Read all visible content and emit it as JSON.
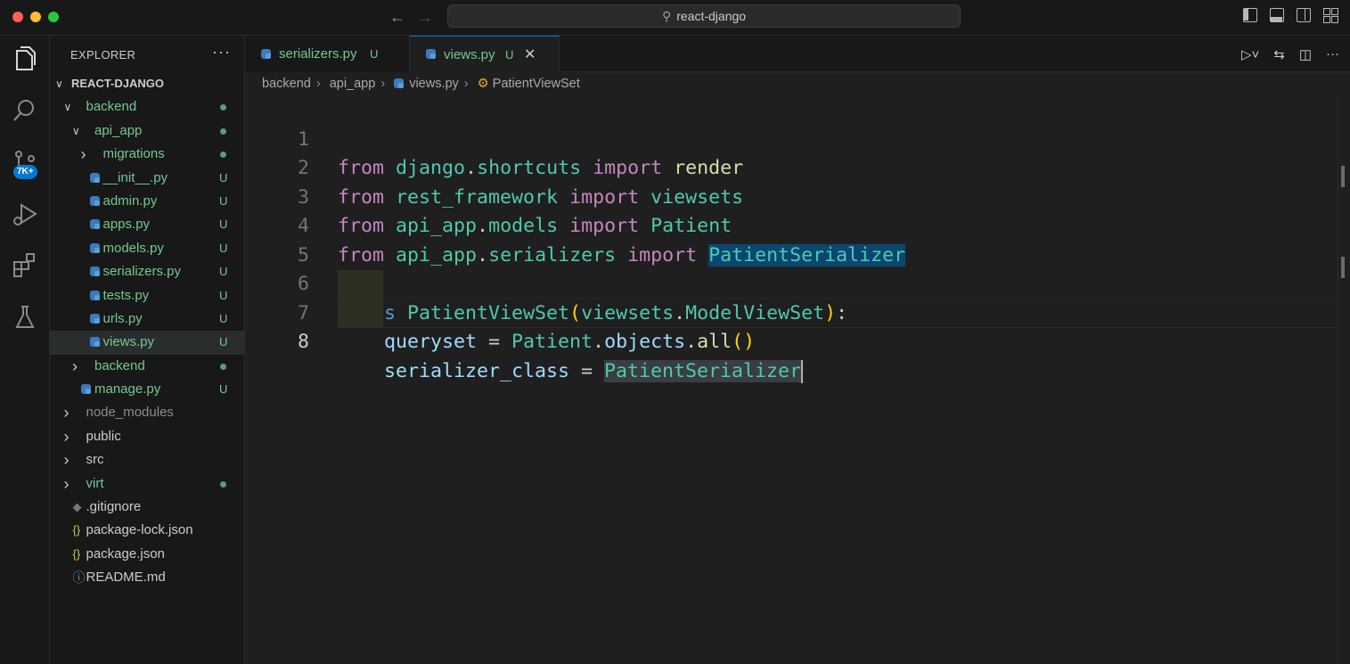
{
  "window": {
    "title": "react-django",
    "traffic_lights": {
      "close": "#ff5f57",
      "minimize": "#febc2e",
      "zoom": "#28c840"
    }
  },
  "activity_bar": {
    "items": [
      "explorer-icon",
      "search-icon",
      "source-control-icon",
      "run-debug-icon",
      "extensions-icon",
      "testing-icon"
    ],
    "source_control_badge": "7K+"
  },
  "explorer": {
    "header": "EXPLORER",
    "more": "···",
    "tree": [
      {
        "label": "REACT-DJANGO",
        "type": "root",
        "expanded": true,
        "depth": 0,
        "status": ""
      },
      {
        "label": "backend",
        "type": "folder",
        "expanded": true,
        "depth": 1,
        "status": "dot"
      },
      {
        "label": "api_app",
        "type": "folder",
        "expanded": true,
        "depth": 2,
        "status": "dot"
      },
      {
        "label": "migrations",
        "type": "folder",
        "expanded": false,
        "depth": 3,
        "status": "dot"
      },
      {
        "label": "__init__.py",
        "type": "py",
        "depth": 3,
        "status": "U"
      },
      {
        "label": "admin.py",
        "type": "py",
        "depth": 3,
        "status": "U"
      },
      {
        "label": "apps.py",
        "type": "py",
        "depth": 3,
        "status": "U"
      },
      {
        "label": "models.py",
        "type": "py",
        "depth": 3,
        "status": "U"
      },
      {
        "label": "serializers.py",
        "type": "py",
        "depth": 3,
        "status": "U"
      },
      {
        "label": "tests.py",
        "type": "py",
        "depth": 3,
        "status": "U"
      },
      {
        "label": "urls.py",
        "type": "py",
        "depth": 3,
        "status": "U"
      },
      {
        "label": "views.py",
        "type": "py",
        "depth": 3,
        "status": "U",
        "selected": true
      },
      {
        "label": "backend",
        "type": "folder",
        "expanded": false,
        "depth": 2,
        "status": "dot"
      },
      {
        "label": "manage.py",
        "type": "py",
        "depth": 2,
        "status": "U"
      },
      {
        "label": "node_modules",
        "type": "folder",
        "expanded": false,
        "depth": 1,
        "status": "",
        "dim": true
      },
      {
        "label": "public",
        "type": "folder",
        "expanded": false,
        "depth": 1,
        "status": ""
      },
      {
        "label": "src",
        "type": "folder",
        "expanded": false,
        "depth": 1,
        "status": ""
      },
      {
        "label": "virt",
        "type": "folder",
        "expanded": false,
        "depth": 1,
        "status": "dot"
      },
      {
        "label": ".gitignore",
        "type": "git",
        "depth": 1,
        "status": ""
      },
      {
        "label": "package-lock.json",
        "type": "json",
        "depth": 1,
        "status": ""
      },
      {
        "label": "package.json",
        "type": "json",
        "depth": 1,
        "status": ""
      },
      {
        "label": "README.md",
        "type": "info",
        "depth": 1,
        "status": ""
      }
    ]
  },
  "tabs": [
    {
      "name": "serializers.py",
      "status": "U",
      "active": false
    },
    {
      "name": "views.py",
      "status": "U",
      "active": true,
      "close": "✕"
    }
  ],
  "breadcrumb": [
    "backend",
    "api_app",
    "views.py",
    "PatientViewSet"
  ],
  "editor": {
    "lines": [
      {
        "num": "1"
      },
      {
        "num": "2"
      },
      {
        "num": "3"
      },
      {
        "num": "4"
      },
      {
        "num": "5"
      },
      {
        "num": "6"
      },
      {
        "num": "7"
      },
      {
        "num": "8",
        "current": true
      }
    ],
    "tokens": {
      "from": "from",
      "import": "import",
      "class": "class",
      "django": "django",
      "dot": ".",
      "shortcuts": "shortcuts",
      "render": "render",
      "rest_framework": "rest_framework",
      "viewsets": "viewsets",
      "api_app": "api_app",
      "models": "models",
      "Patient": "Patient",
      "serializers": "serializers",
      "PatientSerializer": "PatientSerializer",
      "PatientViewSet": "PatientViewSet",
      "lparen": "(",
      "rparen": ")",
      "colon": ":",
      "ModelViewSet": "ModelViewSet",
      "queryset": "queryset",
      "eq": " = ",
      "objects": "objects",
      "all": "all",
      "parens": "()",
      "serializer_class": "serializer_class"
    }
  }
}
